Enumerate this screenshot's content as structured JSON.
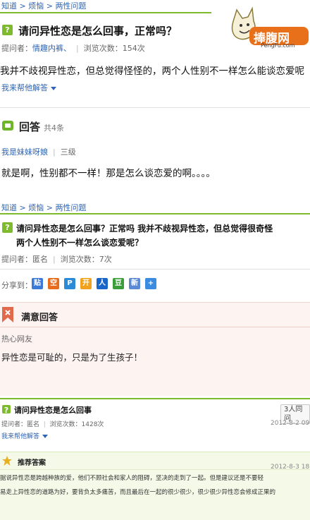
{
  "top": {
    "breadcrumb": [
      "知道",
      "烦恼",
      "两性问题"
    ],
    "crumb_sep": ">",
    "question_title": "请问异性恋是怎么回事，正常吗？",
    "asker_label": "提问者：",
    "asker_name": "情趣内裤、",
    "views_label": "浏览次数：154次",
    "question_body": "我并不歧视异性恋，但总觉得怪怪的，两个人性别不一样怎么能谈恋爱呢",
    "help_answer": "我来帮他解答",
    "answers_title": "回答",
    "answers_count": "共4条",
    "answer_user": "我是妹妹呀娘",
    "answer_level": "三级",
    "answer_text": "就是啊，性别都不一样！那是怎么谈恋爱的啊。。。。",
    "logo_text": "捧腹网",
    "logo_sub": "PengFu.com"
  },
  "middle": {
    "breadcrumb": [
      "知道",
      "烦恼",
      "两性问题"
    ],
    "crumb_sep": ">",
    "question_line1": "请问异性恋是怎么回事？正常吗  我并不歧视异性恋，但总觉得很奇怪",
    "question_line2": "两个人性别不一样怎么谈恋爱呢？",
    "asker": "提问者：匿名",
    "views": "浏览次数：7次",
    "share_label": "分享到：",
    "share_icons": [
      {
        "name": "tieba-icon",
        "glyph": "贴",
        "color": "#3d7ad8"
      },
      {
        "name": "qzone-icon",
        "glyph": "空",
        "color": "#e86c1e"
      },
      {
        "name": "renren-icon",
        "glyph": "P",
        "color": "#2b8bd6"
      },
      {
        "name": "kaixin-icon",
        "glyph": "开",
        "color": "#f0a21c"
      },
      {
        "name": "renren2-icon",
        "glyph": "人",
        "color": "#1a66c8"
      },
      {
        "name": "douban-icon",
        "glyph": "豆",
        "color": "#3a9d3a"
      },
      {
        "name": "sina-icon",
        "glyph": "新",
        "color": "#5a8ad6"
      },
      {
        "name": "more-icon",
        "glyph": "+",
        "color": "#3b8be0"
      }
    ],
    "best_title": "满意回答",
    "best_user": "热心网友",
    "best_text": "异性恋是可耻的，只是为了生孩子！"
  },
  "bottom": {
    "question_title": "请问异性恋是怎么回事",
    "tag": "3人同问",
    "asker": "提问者：匿名",
    "views": "浏览次数：1428次",
    "date1": "2012-8-2 09:3",
    "help_answer": "我来帮他解答",
    "rec_title": "推荐答案",
    "date2": "2012-8-3 18:3",
    "rec_line1": "据说异性恋是跨越种族的爱，他们不顾社会和家人的阻碍，坚决的走到了一起。但是建议还是不要轻",
    "rec_line2": "易走上异性恋的道路为好，要背负太多痛苦，而且最后在一起的很少很少，很少很少异性恋会修成正果的"
  }
}
